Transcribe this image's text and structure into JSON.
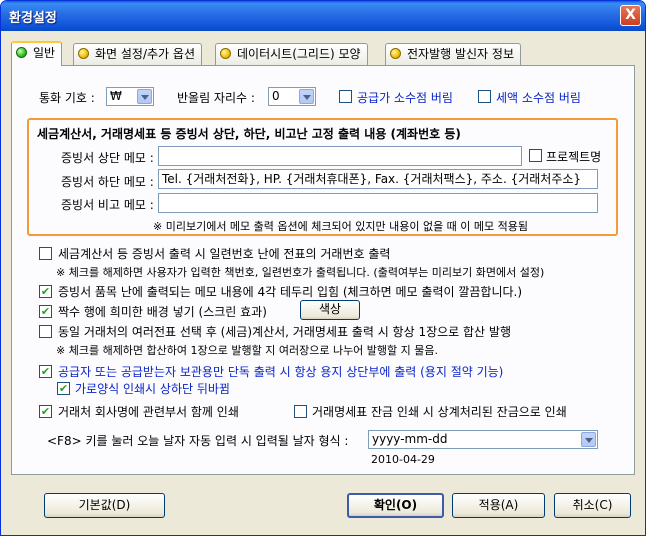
{
  "window": {
    "title": "환경설정",
    "close_label": "X"
  },
  "tabs": [
    {
      "label": "일반",
      "active": true,
      "dot": "green"
    },
    {
      "label": "화면 설정/추가 옵션",
      "dot": "yellow"
    },
    {
      "label": "데이터시트(그리드) 모양",
      "dot": "yellow"
    },
    {
      "label": "전자발행 발신자 정보",
      "dot": "yellow"
    }
  ],
  "currency": {
    "label": "통화 기호 :",
    "value": "₩"
  },
  "rounding": {
    "label": "반올림 자리수 :",
    "value": "0"
  },
  "discard_supply_decimal": {
    "label": "공급가 소수점 버림",
    "checked": false
  },
  "discard_tax_decimal": {
    "label": "세액 소수점 버림",
    "checked": false
  },
  "memo_group": {
    "title": "세금계산서, 거래명세표 등 증빙서 상단, 하단, 비고난 고정 출력 내용 (계좌번호 등)",
    "top_memo_label": "증빙서 상단 메모 :",
    "top_memo_value": "",
    "project_name": {
      "label": "프로젝트명",
      "checked": false
    },
    "bottom_memo_label": "증빙서 하단 메모 :",
    "bottom_memo_value": "Tel. {거래처전화}, HP. {거래처휴대폰}, Fax. {거래처팩스},  주소. {거래처주소}",
    "note_memo_label": "증빙서 비고 메모 :",
    "note_memo_value": "",
    "note": "※ 미리보기에서 메모 출력 옵션에 체크되어 있지만 내용이 없을 때 이 메모 적용됨"
  },
  "options": {
    "print_slip_number": {
      "label": "세금계산서 등 증빙서 출력 시 일련번호 난에 전표의 거래번호 출력",
      "checked": false,
      "note": "※ 체크를 해제하면 사용자가 입력한 책번호, 일련번호가 출력됩니다. (출력여부는 미리보기 화면에서 설정)"
    },
    "memo_border": {
      "label": "증빙서 품목 난에 출력되는 메모 내용에 4각 테두리 입힘 (체크하면 메모 출력이 깔끔합니다.)",
      "checked": true
    },
    "even_row_bg": {
      "label": "짝수 행에 희미한 배경 넣기 (스크린 효과)",
      "checked": true,
      "color_button": "색상"
    },
    "merge_multi": {
      "label": "동일 거래처의 여러전표 선택 후 (세금)계산서, 거래명세표 출력 시 항상 1장으로 합산 발행",
      "checked": false,
      "note": "※ 체크를 해제하면 합산하여 1장으로 발행할 지 여러장으로 나누어 발행할 지 물음."
    },
    "supplier_copy_only": {
      "label": "공급자 또는 공급받는자 보관용만 단독 출력 시 항상 용지 상단부에 출력 (용지 절약 기능)",
      "checked": true
    },
    "landscape_flip": {
      "label": "가로양식 인쇄시 상하단 뒤바뀜",
      "checked": true
    },
    "print_department": {
      "label": "거래처 회사명에 관련부서 함께 인쇄",
      "checked": true
    },
    "print_offset_balance": {
      "label": "거래명세표 잔금 인쇄 시 상계처리된 잔금으로 인쇄",
      "checked": false
    }
  },
  "date_format": {
    "label": "<F8> 키를 눌러 오늘 날자 자동 입력 시 입력될 날자 형식 :",
    "value": "yyyy-mm-dd",
    "preview": "2010-04-29"
  },
  "buttons": {
    "default": "기본값(D)",
    "ok": "확인(O)",
    "apply": "적용(A)",
    "cancel": "취소(C)"
  },
  "colors": {
    "title_bar": "#0a5fd8",
    "group_border": "#f39a3a",
    "blue_text": "#0a24c8",
    "check": "#21a121"
  }
}
